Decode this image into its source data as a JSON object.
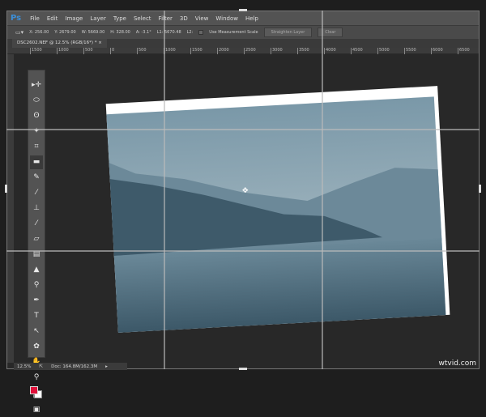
{
  "app_logo": "Ps",
  "menu": [
    "File",
    "Edit",
    "Image",
    "Layer",
    "Type",
    "Select",
    "Filter",
    "3D",
    "View",
    "Window",
    "Help"
  ],
  "options": {
    "x": "X: 256.00",
    "y": "Y: 2679.00",
    "w": "W: 5669.00",
    "h": "H: 328.00",
    "a": "A: -3.1°",
    "l1": "L1: 5670.48",
    "l2": "L2:",
    "measurement_scale": "Use Measurement Scale",
    "straighten": "Straighten Layer",
    "clear": "Clear"
  },
  "document_tab": "DSC2602.NEF @ 12.5% (RGB/16*) *",
  "tab_close": "×",
  "ruler": [
    "1500",
    "1000",
    "500",
    "0",
    "500",
    "1000",
    "1500",
    "2000",
    "2500",
    "3000",
    "3500",
    "4000",
    "4500",
    "5000",
    "5500",
    "6000",
    "6500"
  ],
  "tools": [
    "move",
    "marquee",
    "lasso",
    "magic-wand",
    "crop",
    "ruler",
    "healing",
    "brush",
    "stamp",
    "history-brush",
    "eraser",
    "gradient",
    "blur",
    "dodge",
    "pen",
    "type",
    "path-select",
    "shape",
    "hand",
    "zoom"
  ],
  "status": {
    "zoom": "12.5%",
    "doc": "Doc: 164.8M/162.3M"
  },
  "watermark": "wtvid.com",
  "colors": {
    "foreground": "#e0103a",
    "background": "#ffffff",
    "accent": "#3c8fd8"
  }
}
